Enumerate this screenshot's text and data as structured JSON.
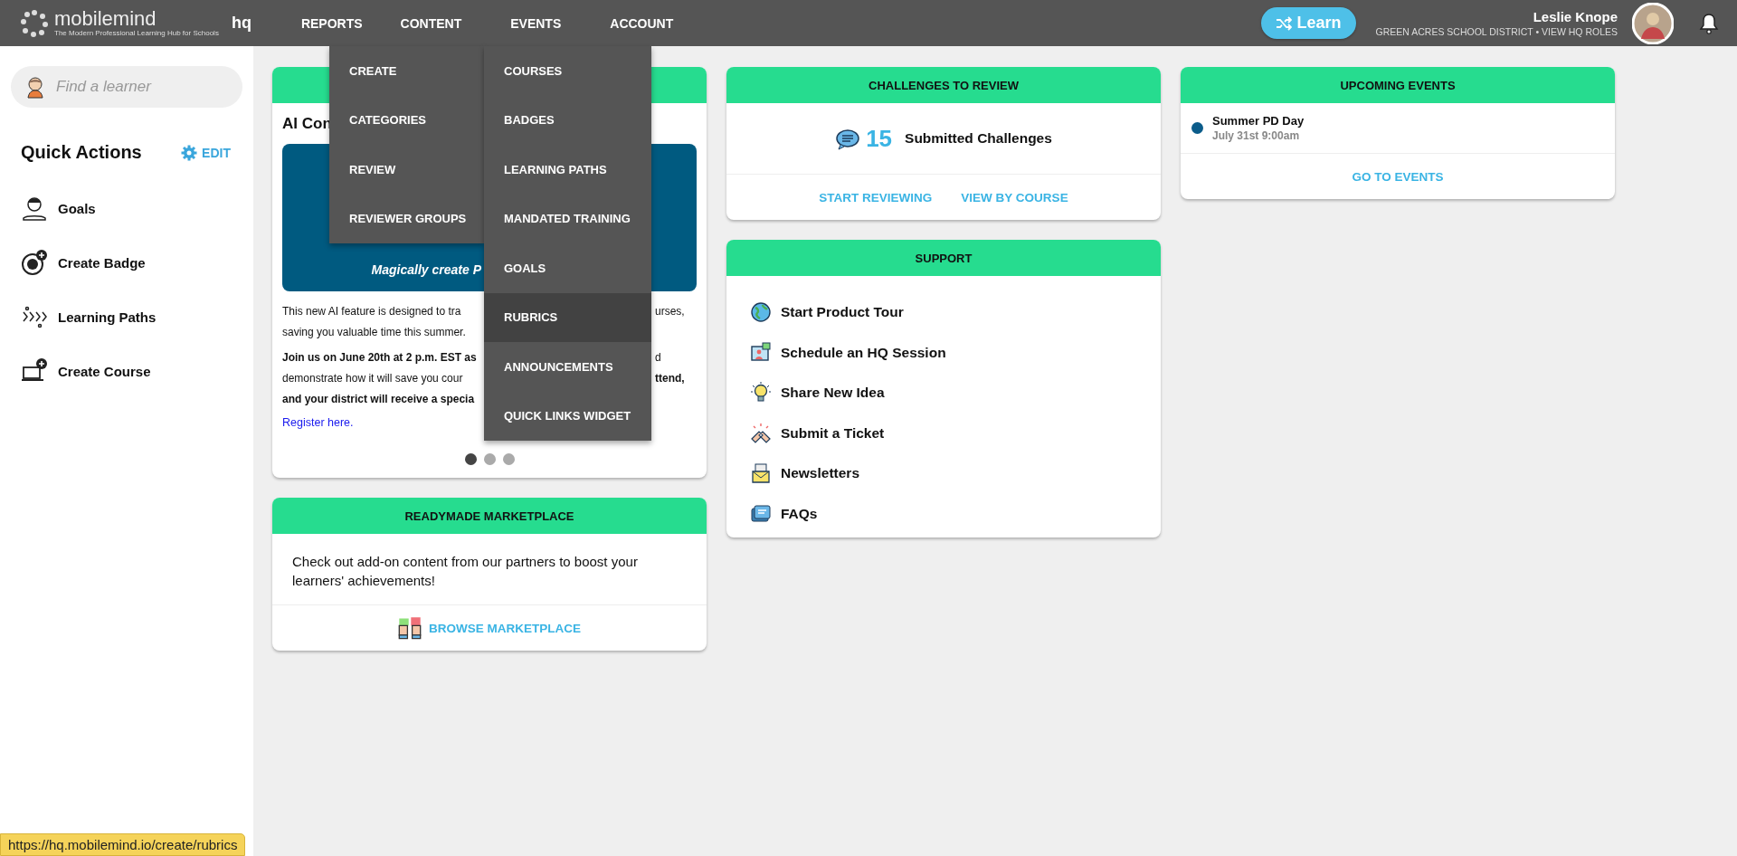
{
  "header": {
    "logo": {
      "name": "mobilemind",
      "tagline": "The Modern Professional Learning Hub for Schools"
    },
    "product": "hq",
    "nav": [
      {
        "label": "REPORTS"
      },
      {
        "label": "CONTENT"
      },
      {
        "label": "EVENTS"
      },
      {
        "label": "ACCOUNT"
      }
    ],
    "learn_button": "Learn",
    "user": {
      "name": "Leslie Knope",
      "subline": "GREEN ACRES SCHOOL DISTRICT • VIEW HQ ROLES"
    }
  },
  "content_menu": {
    "columns": [
      [
        {
          "label": "CREATE",
          "selected": false
        },
        {
          "label": "CATEGORIES",
          "selected": false
        },
        {
          "label": "REVIEW",
          "selected": false
        },
        {
          "label": "REVIEWER GROUPS",
          "selected": false
        }
      ],
      [
        {
          "label": "COURSES",
          "selected": false
        },
        {
          "label": "BADGES",
          "selected": false
        },
        {
          "label": "LEARNING PATHS",
          "selected": false
        },
        {
          "label": "MANDATED TRAINING",
          "selected": false
        },
        {
          "label": "GOALS",
          "selected": false
        },
        {
          "label": "RUBRICS",
          "selected": true
        },
        {
          "label": "ANNOUNCEMENTS",
          "selected": false
        },
        {
          "label": "QUICK LINKS WIDGET",
          "selected": false
        }
      ]
    ]
  },
  "sidebar": {
    "search": {
      "placeholder": "Find a learner"
    },
    "title": "Quick Actions",
    "edit": "EDIT",
    "items": [
      {
        "label": "Goals"
      },
      {
        "label": "Create Badge"
      },
      {
        "label": "Learning Paths"
      },
      {
        "label": "Create Course"
      }
    ]
  },
  "feature_card": {
    "title": "AI Con",
    "banner_caption": "Magically create P",
    "lines": [
      {
        "left": {
          "text": "This new AI feature is designed to tra",
          "bold": false
        },
        "right": {
          "text": "urses,",
          "bold": false
        }
      },
      {
        "left": {
          "text": "saving you valuable time this summer.",
          "bold": false
        }
      },
      {
        "left": {
          "text": "Join us on June 20th at 2 p.m. EST as",
          "bold": true
        },
        "right": {
          "text": "d",
          "bold": false
        }
      },
      {
        "left": {
          "text": "demonstrate how it will save you cour",
          "bold": false
        },
        "right": {
          "text": "ttend,",
          "bold": true
        }
      },
      {
        "left": {
          "text": "and your district will receive a specia",
          "bold": true
        }
      }
    ],
    "link": "Register here.",
    "dots": [
      {
        "selected": true
      },
      {
        "selected": false
      },
      {
        "selected": false
      }
    ]
  },
  "marketplace": {
    "title": "READYMADE MARKETPLACE",
    "text": "Check out add-on content from our partners to boost your learners' achievements!",
    "link": "BROWSE MARKETPLACE"
  },
  "challenges": {
    "title": "CHALLENGES TO REVIEW",
    "count": "15",
    "label": "Submitted Challenges",
    "links": [
      "START REVIEWING",
      "VIEW BY COURSE"
    ]
  },
  "support": {
    "title": "SUPPORT",
    "items": [
      {
        "label": "Start Product Tour"
      },
      {
        "label": "Schedule an HQ Session"
      },
      {
        "label": "Share New Idea"
      },
      {
        "label": "Submit a Ticket"
      },
      {
        "label": "Newsletters"
      },
      {
        "label": "FAQs"
      }
    ]
  },
  "events": {
    "title": "UPCOMING EVENTS",
    "items": [
      {
        "title": "Summer PD Day",
        "time": "July 31st 9:00am",
        "color": "#0b5c8a"
      }
    ],
    "link": "GO TO EVENTS"
  },
  "status_url": "https://hq.mobilemind.io/create/rubrics"
}
